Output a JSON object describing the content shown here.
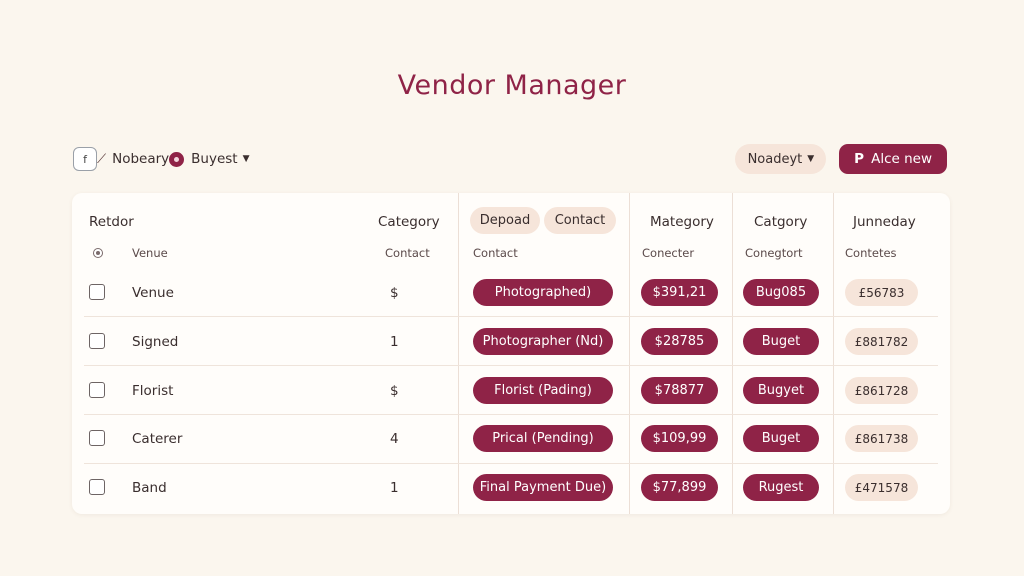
{
  "title": "Vendor Manager",
  "toolbar": {
    "fb_icon": "f",
    "notify_label": "Nobeary",
    "budget_label": "Buyest",
    "select_label": "Noadeyt",
    "add_label": "Alce new",
    "add_glyph": "P"
  },
  "colors": {
    "accent": "#8f2347",
    "pill_light": "#f6e5da",
    "background": "#fbf6ee"
  },
  "table": {
    "headers": {
      "vendor": "Retdor",
      "category": "Category",
      "depoad_pill": "Depoad",
      "contact_pill": "Contact",
      "kategory": "Mategory",
      "category2": "Catgory",
      "junneday": "Junneday"
    },
    "subheaders": {
      "venue": "Venue",
      "contact": "Contact",
      "contact2": "Contact",
      "conecter": "Conecter",
      "conegtort": "Conegtort",
      "contetes": "Contetes"
    },
    "rows": [
      {
        "name": "Venue",
        "count": "$",
        "status": "Photographed)",
        "amount": "$391,21",
        "tag": "Bug085",
        "value": "£56783"
      },
      {
        "name": "Signed",
        "count": "1",
        "status": "Photographer (Nd)",
        "amount": "$28785",
        "tag": "Buget",
        "value": "£881782"
      },
      {
        "name": "Florist",
        "count": "$",
        "status": "Florist (Pading)",
        "amount": "$78877",
        "tag": "Bugyet",
        "value": "£861728"
      },
      {
        "name": "Caterer",
        "count": "4",
        "status": "Prical (Pending)",
        "amount": "$109,99",
        "tag": "Buget",
        "value": "£861738"
      },
      {
        "name": "Band",
        "count": "1",
        "status": "Final Payment Due)",
        "amount": "$77,899",
        "tag": "Rugest",
        "value": "£471578"
      }
    ]
  }
}
